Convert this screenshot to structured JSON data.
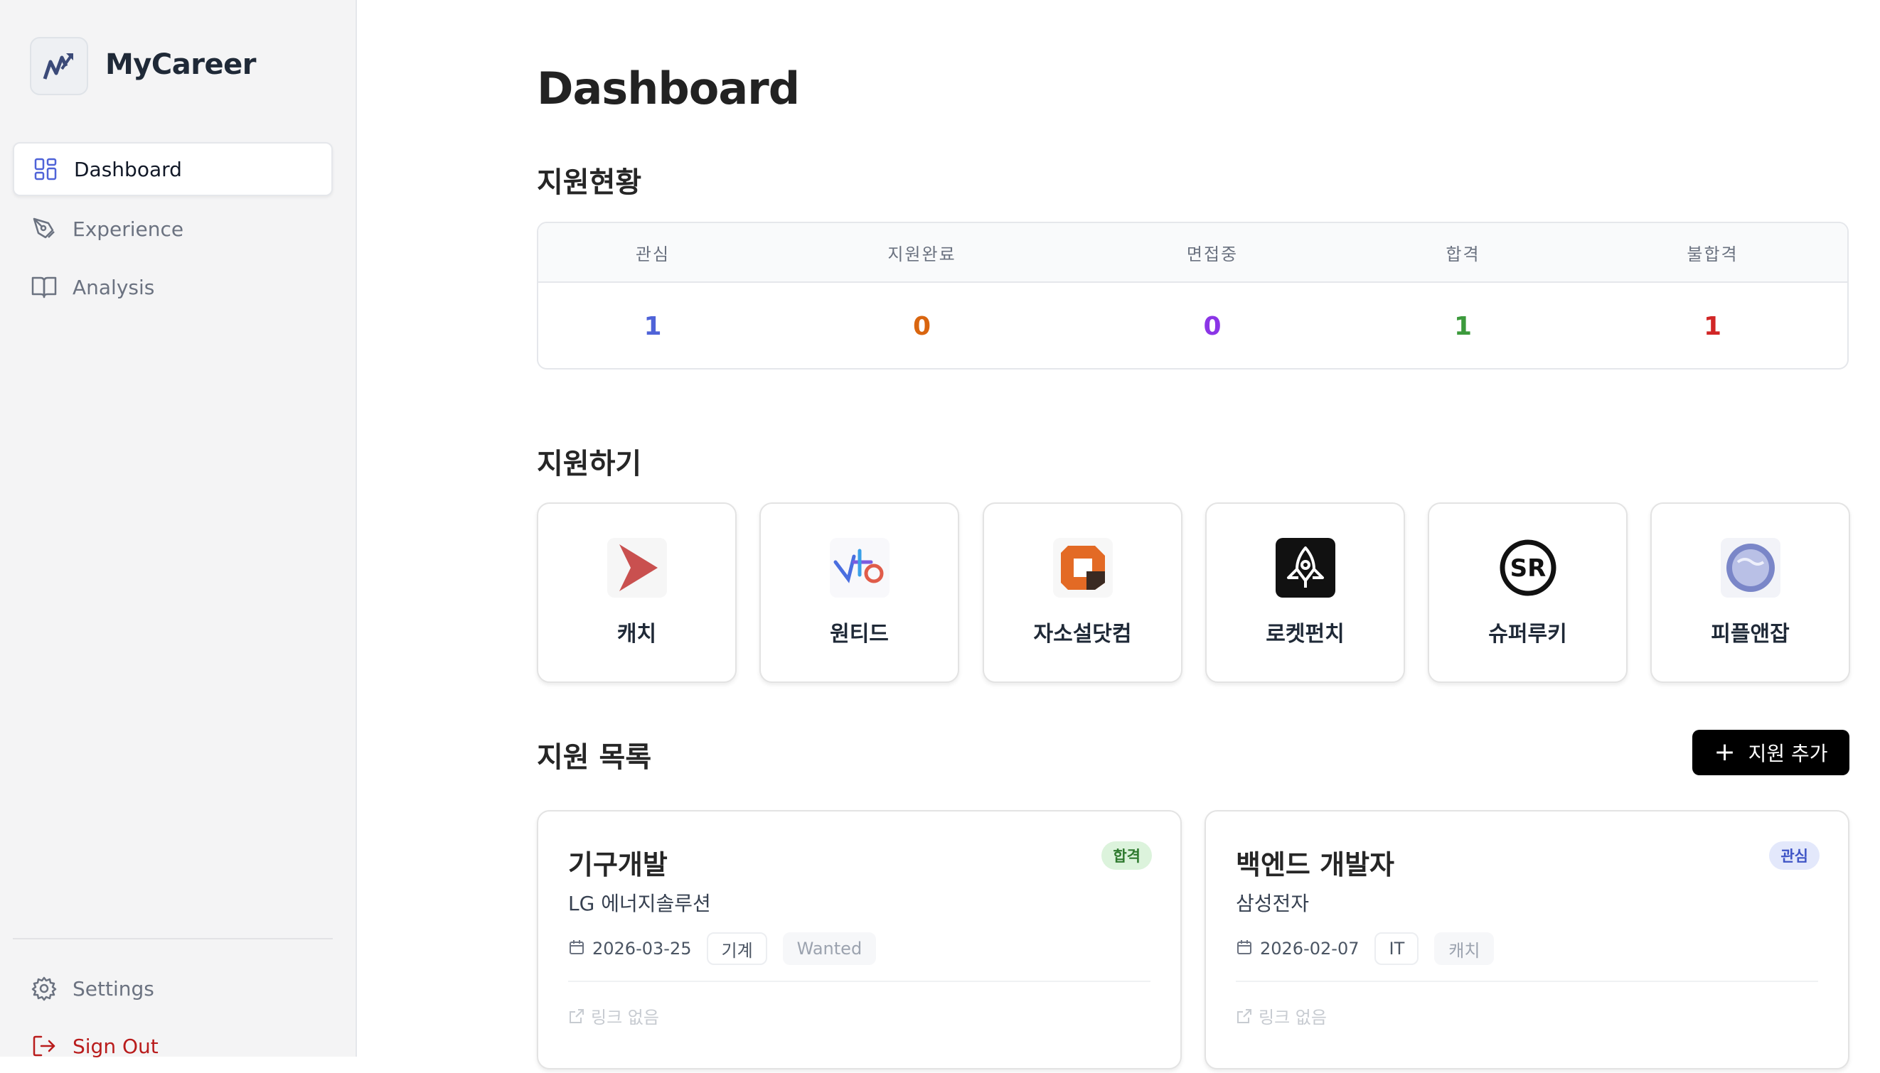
{
  "brand": "MyCareer",
  "sidebar": {
    "items": [
      {
        "label": "Dashboard",
        "icon": "grid-icon",
        "active": true
      },
      {
        "label": "Experience",
        "icon": "pen-tool-icon"
      },
      {
        "label": "Analysis",
        "icon": "book-open-icon"
      }
    ],
    "settings_label": "Settings",
    "signout_label": "Sign Out"
  },
  "page_title": "Dashboard",
  "status": {
    "title": "지원현황",
    "columns": [
      {
        "label": "관심",
        "count": "1",
        "color": "#4f63d8"
      },
      {
        "label": "지원완료",
        "count": "0",
        "color": "#d9650f"
      },
      {
        "label": "면접중",
        "count": "0",
        "color": "#8b35e6"
      },
      {
        "label": "합격",
        "count": "1",
        "color": "#3c9a3c"
      },
      {
        "label": "불합격",
        "count": "1",
        "color": "#d12626"
      }
    ]
  },
  "apply": {
    "title": "지원하기",
    "sites": [
      {
        "name": "캐치",
        "icon": "catch-logo-icon"
      },
      {
        "name": "원티드",
        "icon": "wanted-logo-icon"
      },
      {
        "name": "자소설닷컴",
        "icon": "jasoseol-logo-icon"
      },
      {
        "name": "로켓펀치",
        "icon": "rocketpunch-logo-icon"
      },
      {
        "name": "슈퍼루키",
        "icon": "superookie-logo-icon"
      },
      {
        "name": "피플앤잡",
        "icon": "peoplenjob-logo-icon"
      }
    ]
  },
  "applications": {
    "title": "지원 목록",
    "add_label": "지원 추가",
    "items": [
      {
        "title": "기구개발",
        "company": "LG 에너지솔루션",
        "status": "합격",
        "status_bg": "#dcf3dc",
        "status_color": "#2f7a2f",
        "date": "2026-03-25",
        "category": "기계",
        "source": "Wanted",
        "link": "링크 없음"
      },
      {
        "title": "백엔드 개발자",
        "company": "삼성전자",
        "status": "관심",
        "status_bg": "#e3e8fb",
        "status_color": "#3f55c6",
        "date": "2026-02-07",
        "category": "IT",
        "source": "캐치",
        "link": "링크 없음"
      }
    ]
  }
}
